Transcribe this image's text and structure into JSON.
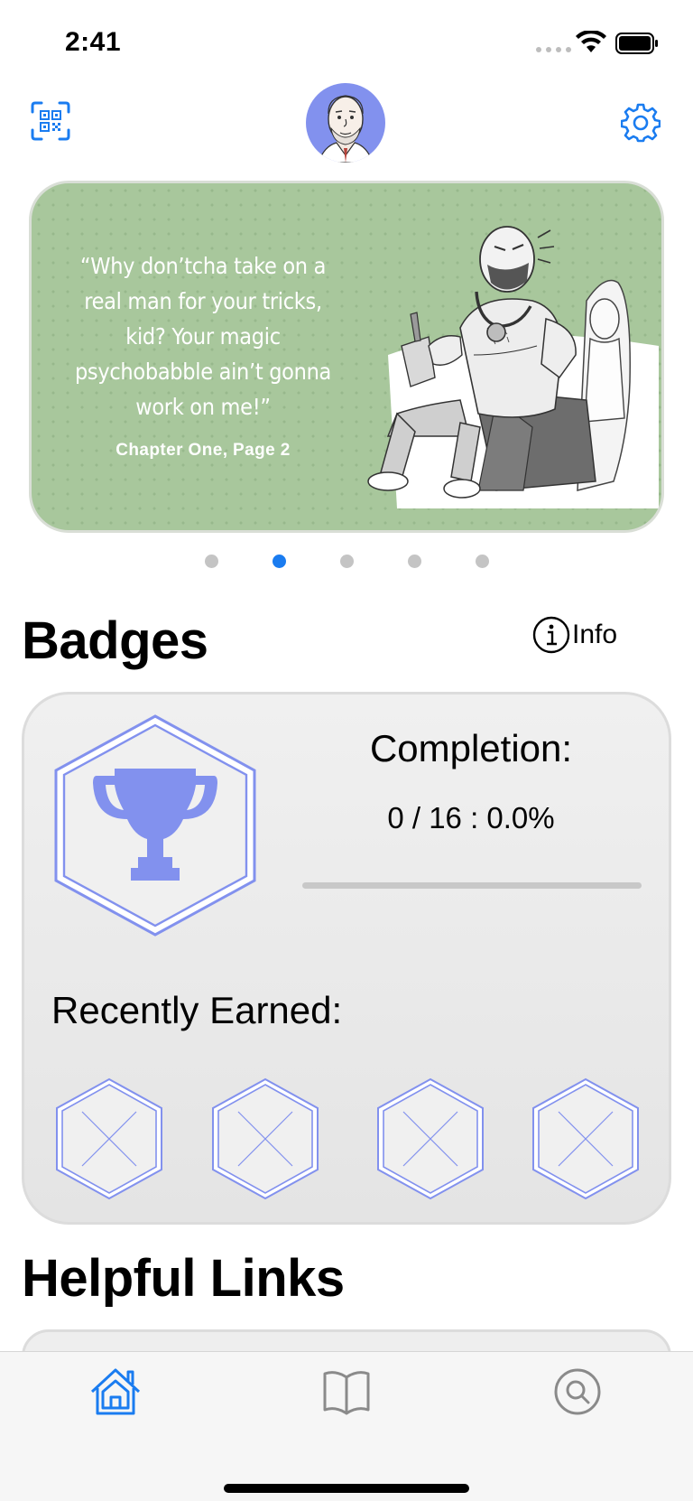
{
  "status_bar": {
    "time": "2:41"
  },
  "carousel": {
    "quote": "“Why don’tcha take on a real man for your tricks, kid? Your magic psychobabble ain’t gonna work on me!”",
    "source": "Chapter One, Page 2",
    "page_count": 5,
    "active_page": 2,
    "background_color": "#a8c79c"
  },
  "badges": {
    "title": "Badges",
    "info_label": "Info",
    "completion_label": "Completion:",
    "completion_value": "0 / 16 : 0.0%",
    "completion_fraction": 0.0,
    "recently_earned_label": "Recently Earned:",
    "recent_slots": 4,
    "accent_color": "#8291ee"
  },
  "helpful_links": {
    "title": "Helpful Links"
  },
  "tab_bar": {
    "tabs": [
      "home-icon",
      "book-icon",
      "search-icon"
    ],
    "active_tab": "home-icon",
    "active_color": "#1a7cf0",
    "inactive_color": "#8a8a8a"
  }
}
